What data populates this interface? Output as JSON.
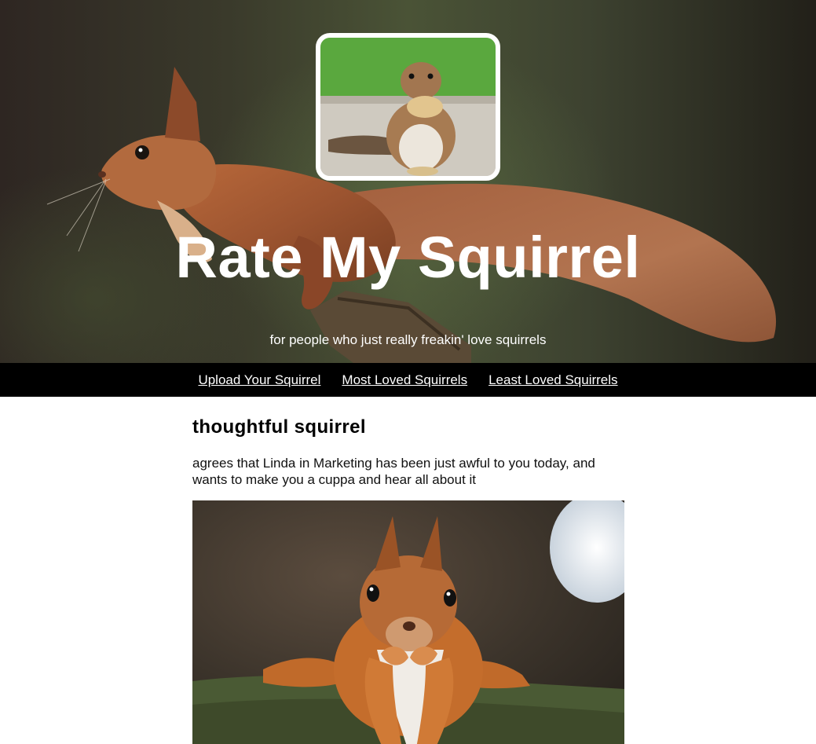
{
  "hero": {
    "title": "Rate My Squirrel",
    "subtitle": "for people who just really freakin' love squirrels"
  },
  "nav": {
    "items": [
      {
        "label": "Upload Your Squirrel"
      },
      {
        "label": "Most Loved Squirrels"
      },
      {
        "label": "Least Loved Squirrels"
      }
    ]
  },
  "post": {
    "title": "thoughtful squirrel",
    "description": "agrees that Linda in Marketing has been just awful to you today, and wants to make you a cuppa and hear all about it"
  },
  "colors": {
    "nav_background": "#000000",
    "nav_text": "#ffffff",
    "hero_text": "#ffffff",
    "page_background": "#ffffff"
  }
}
